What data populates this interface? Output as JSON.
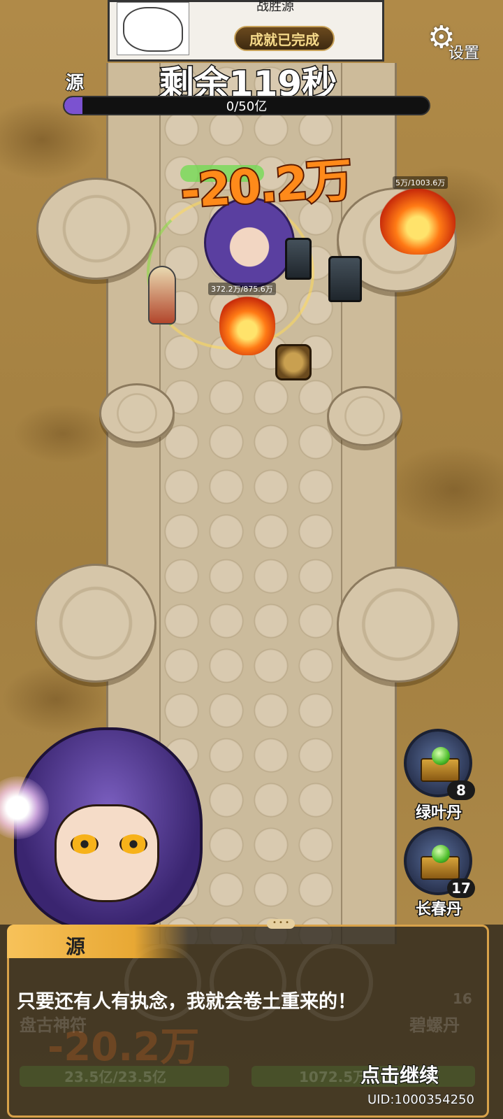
{
  "achievement": {
    "header": "战胜源",
    "badge": "成就已完成"
  },
  "settings": {
    "icon": "gear-icon",
    "label": "设置"
  },
  "timer": {
    "text": "剩余119秒"
  },
  "boss": {
    "name": "源",
    "hp_text": "0/50亿",
    "hp_fraction": 0.05
  },
  "combat": {
    "damage_popup": "-20.2万",
    "enemy_hp_right": "5万/1003.6万",
    "ally_hp": "372.2万/875.6万"
  },
  "items": [
    {
      "name": "绿叶丹",
      "count": "8",
      "icon": "green-pill-chest-icon"
    },
    {
      "name": "长春丹",
      "count": "17",
      "icon": "green-pill-chest-icon"
    }
  ],
  "dialog": {
    "speaker": "源",
    "line": "只要还有人有执念，我就会卷土重来的！",
    "continue_hint": "点击继续",
    "uid": "UID:1000354250"
  },
  "background_hud": {
    "skill_name": "盘古神符",
    "item_name": "碧螺丹",
    "item_count": "16",
    "damage": "-20.2万",
    "left_hp": "23.5亿/23.5亿",
    "right_hp": "1072.5万/1072.5万"
  },
  "colors": {
    "hp_fill": "#7b52d0",
    "badge_text": "#f5d98a",
    "damage": "#ff8a1a",
    "dialog_accent": "#e8a834"
  }
}
